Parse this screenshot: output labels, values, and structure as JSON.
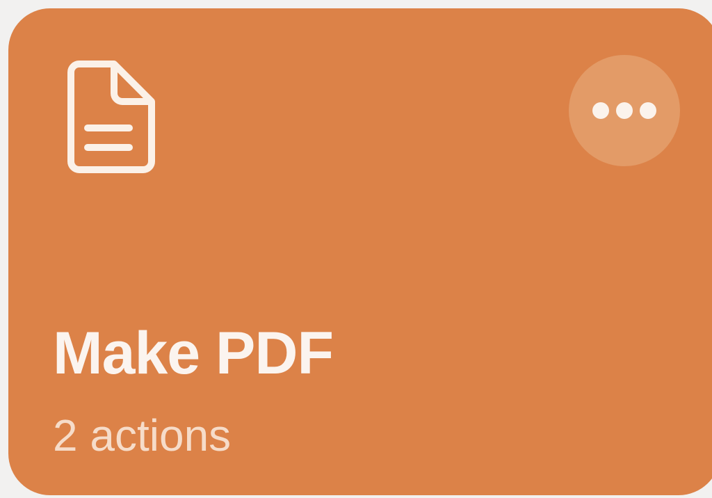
{
  "card": {
    "title": "Make PDF",
    "subtitle": "2 actions",
    "icon": "document-icon",
    "more_icon": "ellipsis-icon",
    "color": "#dc8248"
  }
}
